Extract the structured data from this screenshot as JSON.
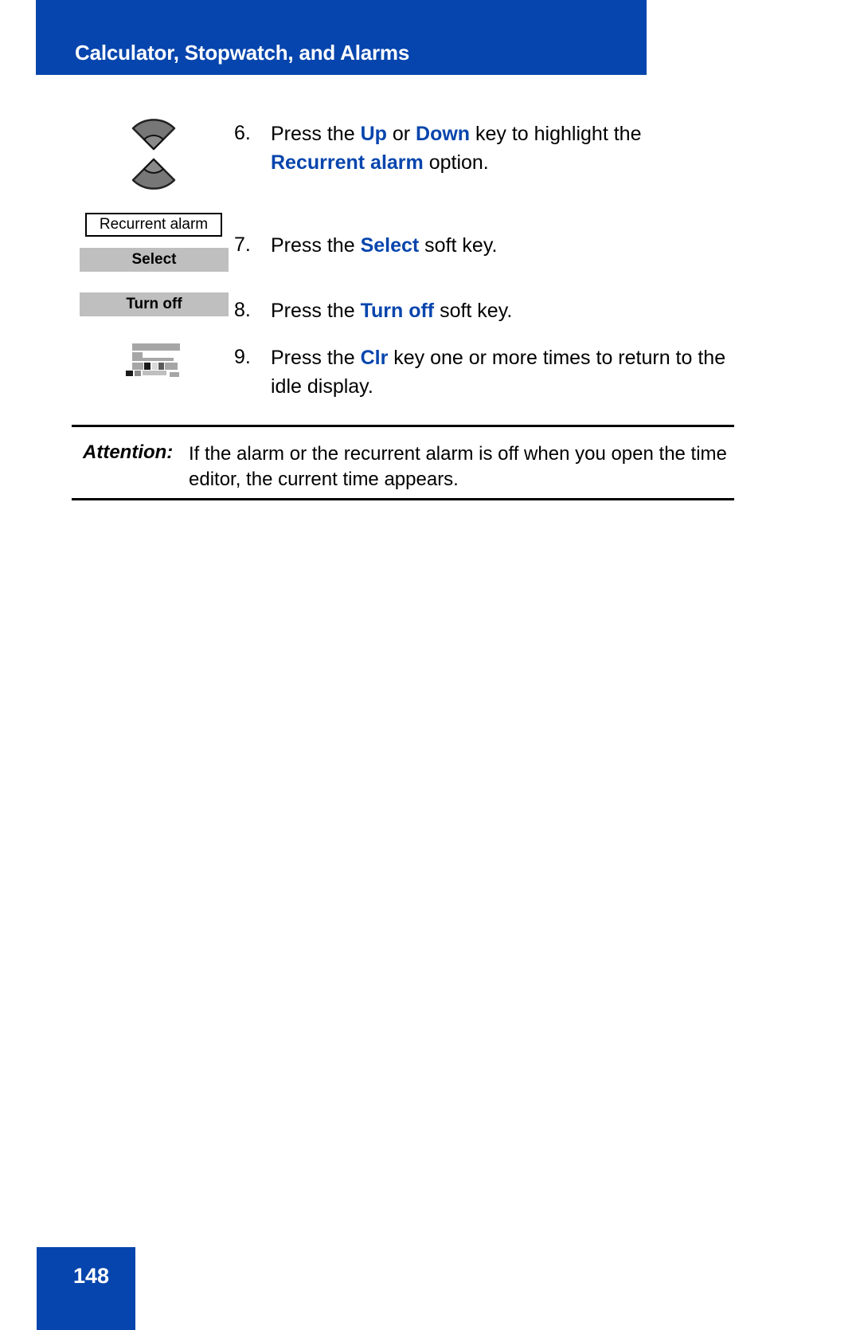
{
  "header": {
    "title": "Calculator, Stopwatch, and Alarms"
  },
  "steps": [
    {
      "number": "6.",
      "icon": "navigation-up-down-key-icon",
      "segments": [
        {
          "text": "Press the ",
          "style": "normal"
        },
        {
          "text": "Up",
          "style": "keyword"
        },
        {
          "text": " or ",
          "style": "normal"
        },
        {
          "text": "Down",
          "style": "keyword"
        },
        {
          "text": " key to highlight the ",
          "style": "normal"
        },
        {
          "text": "Recurrent alarm",
          "style": "keyword"
        },
        {
          "text": " option.",
          "style": "normal"
        }
      ],
      "plain": "Press the Up or Down key to highlight the Recurrent alarm option."
    },
    {
      "number": "7.",
      "icon": "select-soft-key-icon",
      "segments": [
        {
          "text": "Press the ",
          "style": "normal"
        },
        {
          "text": "Select",
          "style": "keyword"
        },
        {
          "text": " soft key.",
          "style": "normal"
        }
      ],
      "plain": "Press the Select soft key."
    },
    {
      "number": "8.",
      "icon": "turn-off-soft-key-icon",
      "segments": [
        {
          "text": "Press the ",
          "style": "normal"
        },
        {
          "text": "Turn off",
          "style": "keyword"
        },
        {
          "text": " soft key.",
          "style": "normal"
        }
      ],
      "plain": "Press the Turn off soft key."
    },
    {
      "number": "9.",
      "icon": "clr-key-icon",
      "segments": [
        {
          "text": "Press the ",
          "style": "normal"
        },
        {
          "text": "Clr",
          "style": "keyword"
        },
        {
          "text": " key one or more times to return to the idle display.",
          "style": "normal"
        }
      ],
      "plain": "Press the Clr key one or more times to return to the idle display."
    }
  ],
  "illustrations": {
    "display_line_label": "Recurrent alarm",
    "softkey_select_label": "Select",
    "softkey_turnoff_label": "Turn off"
  },
  "attention": {
    "label": "Attention:",
    "text": "If the alarm or the recurrent alarm is off when you open the time editor, the current time appears."
  },
  "footer": {
    "page_number": "148"
  },
  "colors": {
    "brand_blue": "#0645ad",
    "keyword_blue": "#0645ad",
    "softkey_gray": "#bfbfbf",
    "text_black": "#000000",
    "page_white": "#ffffff"
  }
}
